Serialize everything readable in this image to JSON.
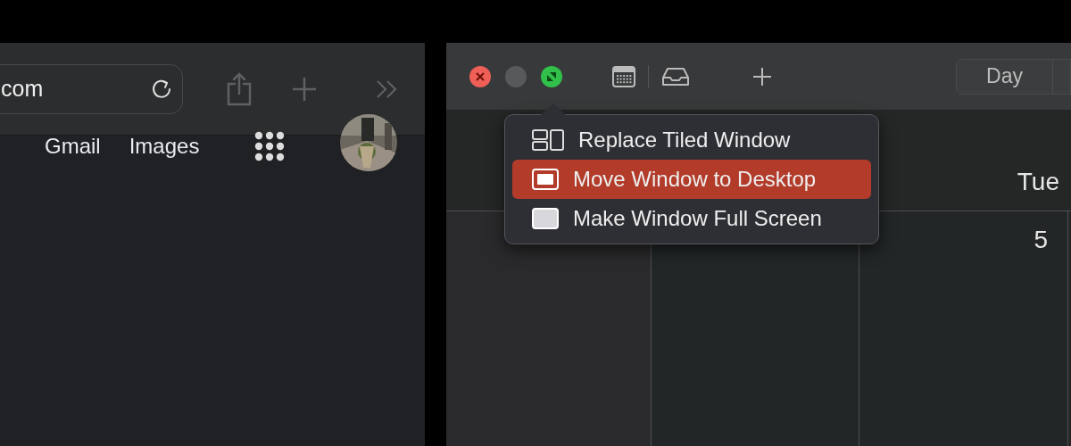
{
  "browser": {
    "address": {
      "value": "com"
    },
    "links": [
      "Gmail",
      "Images"
    ],
    "avatar": {
      "kind": "picture"
    }
  },
  "calendar": {
    "view_tabs": [
      {
        "label": "Day",
        "selected": false
      }
    ],
    "day_header": "Tue",
    "day_number": "5"
  },
  "zoom_menu": {
    "items": [
      {
        "kind": "tile",
        "label": "Replace Tiled Window",
        "selected": false
      },
      {
        "kind": "desktop",
        "label": "Move Window to Desktop",
        "selected": true
      },
      {
        "kind": "fullscreen",
        "label": "Make Window Full Screen",
        "selected": false
      }
    ]
  }
}
